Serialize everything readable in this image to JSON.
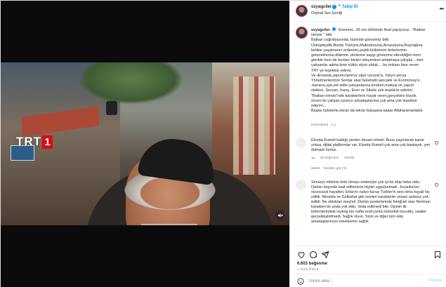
{
  "header": {
    "username": "ozyagciler",
    "separator": "•",
    "follow_label": "Takip Et",
    "audio_label": "Orijinal Ses İçeriği",
    "more_label": "•••"
  },
  "video": {
    "channel_logo_text": "TRT",
    "channel_logo_number": "1"
  },
  "caption": {
    "username": "ozyagciler",
    "lines": [
      "Eveeeet...25 inci bölümde final yapıyoruz...\"Balkan",
      "ninnisi \" bitti.",
      "Balkan coğrafyasında, bizimde görevimiz bitti.",
      "Üsküpteydik,Burda Türküne,Makedonuna,Arnavutuna,Boşnağına",
      "birlikte yaşamanın erdemini,çeşitli kültürlerin birbirlerinin",
      "geleneklerine,dillerine ,dinlerine saygı gösterme efendiliğini hem",
      "gördük hem de bunları bizleri izleyenlere anlatmaya çalıştık....tüm",
      "çalışanlar adeta birer kültür elçisi olduk.... bu imkanı bize veren",
      "TRT ye teşekkür ederiz.",
      "Ve devamla yapımcılarımız uğur uzunok'a, Yalçın ani'ya",
      "Yönetmenlerimiz Serdar akar,Selahatti sancaklı ve Evrimöney'e",
      ",kamera,ışık,set ekibi çalışanlarına,kostüm,makyaj ve yapım",
      "ekibine ,Serzan, İnanç, Eren ve Sibele çok teşekkür ederim.",
      "\"Balkan ninnisi\"nde karakterlere hayat veren,gerçekten büyük",
      "özveri ile çalışan oyuncu arkadaşlarıma çok ama çok teşekkür",
      "ederim...",
      "Başka öykülerle,ekran da tekrar buluşana kadar Allahaısmarladık."
    ],
    "edited_label": "Düzenlendi · 1 g"
  },
  "comments": [
    {
      "text": "Elveda Rumeli kaldığı yerden devam etmeli. Bunu yayınlacak kanal yoksa, dijital platformlar var. Elveda Rumeli çok ama çok başkaydı, yeri dolmadı henüz.",
      "time": "1g",
      "likes": "36 beğenme",
      "reply_label": "Yanıtla",
      "replies_label": "Yanıtları gör (3)"
    },
    {
      "text": "Senaryo ekibinin kötü olması nedeniyle çok iyi bir ekip heba oldu. Dizinin başında vaat edilenlerin hiçbiri uygulanmadı. Jovanka'nın oyunculuk hayalleri, Ertan'ın radyo kurup Türkler'in sesi olma hayali hiç edildi. Mustafa ve Gülbahar gibi sevilen karakterler sessiz sedasız yok edildi. Ne oldukları meçhul. Dizinin posterlerinde fotoğrafı olan Neriman karakteri bir anda yok oldu. Veda edilmedi bile. Dizinin ilk bölümlerindeki reyting her hafta endi çünkü bütünlük bozuldu, vaatler gerçekleştirilmedi. Sağlık olsun. Sizin ve diğer tüm ekip arkadaşlarınızın emeklerine sağlık"
    }
  ],
  "actions": {
    "likes_count": "6.603 beğenme",
    "time_ago": "1 GÜN ÖNCE"
  },
  "add_comment": {
    "placeholder": "Yorum ekle...",
    "post_label": "Paylaş"
  },
  "colors": {
    "accent": "#0095f6",
    "logo_red": "#e30613"
  },
  "icons": [
    "heart-icon",
    "comment-icon",
    "share-icon",
    "bookmark-icon",
    "emoji-icon",
    "mute-icon",
    "verified-icon"
  ]
}
